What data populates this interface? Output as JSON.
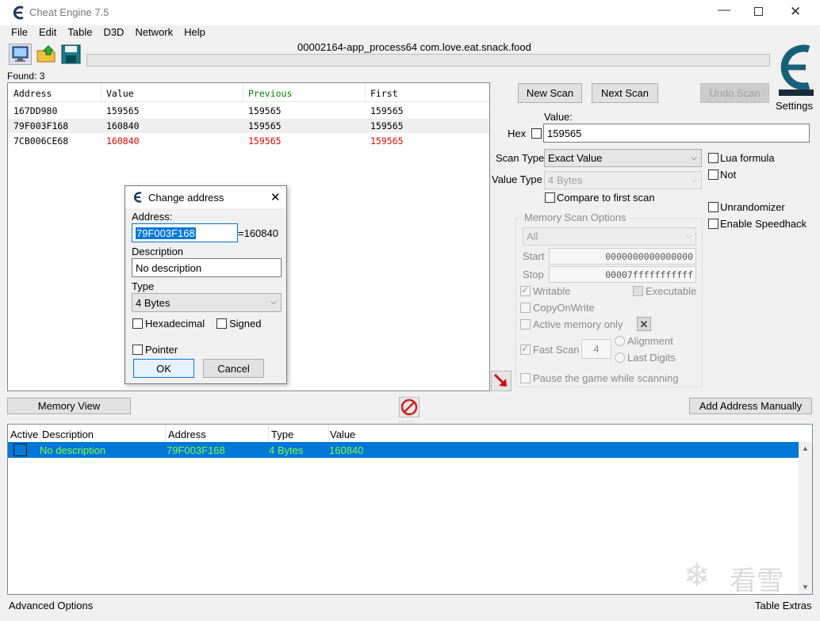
{
  "window": {
    "title": "Cheat Engine 7.5"
  },
  "menu": [
    "File",
    "Edit",
    "Table",
    "D3D",
    "Network",
    "Help"
  ],
  "process_title": "00002164-app_process64 com.love.eat.snack.food",
  "found": "Found: 3",
  "results": {
    "headers": [
      "Address",
      "Value",
      "Previous",
      "First"
    ],
    "rows": [
      [
        "167DD980",
        "159565",
        "159565",
        "159565"
      ],
      [
        "79F003F168",
        "160840",
        "159565",
        "159565"
      ],
      [
        "7CB006CE68",
        "160840",
        "159565",
        "159565"
      ]
    ]
  },
  "scan": {
    "new_scan": "New Scan",
    "next_scan": "Next Scan",
    "undo_scan": "Undo Scan",
    "settings": "Settings",
    "value_label": "Value:",
    "hex_label": "Hex",
    "value": "159565",
    "scan_type_label": "Scan Type",
    "scan_type": "Exact Value",
    "value_type_label": "Value Type",
    "value_type": "4 Bytes",
    "compare_first": "Compare to first scan",
    "lua_formula": "Lua formula",
    "not": "Not",
    "unrandomizer": "Unrandomizer",
    "speedhack": "Enable Speedhack",
    "mem_options_title": "Memory Scan Options",
    "region": "All",
    "start_label": "Start",
    "start": "0000000000000000",
    "stop_label": "Stop",
    "stop": "00007fffffffffff",
    "writable": "Writable",
    "executable": "Executable",
    "copyonwrite": "CopyOnWrite",
    "active_memory": "Active memory only",
    "fast_scan": "Fast Scan",
    "fast_scan_value": "4",
    "alignment": "Alignment",
    "last_digits": "Last Digits",
    "pause_game": "Pause the game while scanning"
  },
  "dialog": {
    "title": "Change address",
    "address_label": "Address:",
    "address": "79F003F168",
    "equals_value": "=160840",
    "description_label": "Description",
    "description": "No description",
    "type_label": "Type",
    "type": "4 Bytes",
    "hexadecimal": "Hexadecimal",
    "signed": "Signed",
    "pointer": "Pointer",
    "ok": "OK",
    "cancel": "Cancel"
  },
  "bottom": {
    "memory_view": "Memory View",
    "add_address": "Add Address Manually",
    "headers": [
      "Active",
      "Description",
      "Address",
      "Type",
      "Value"
    ],
    "rows": [
      [
        "",
        "No description",
        "79F003F168",
        "4 Bytes",
        "160840"
      ]
    ],
    "advanced": "Advanced Options",
    "table_extras": "Table Extras"
  },
  "watermark": "看雪",
  "colors": {
    "selected_row": "#0078d7",
    "changed_value": "#e00000",
    "previous_header": "#008000",
    "bottom_row_text": "#7cff3f"
  }
}
